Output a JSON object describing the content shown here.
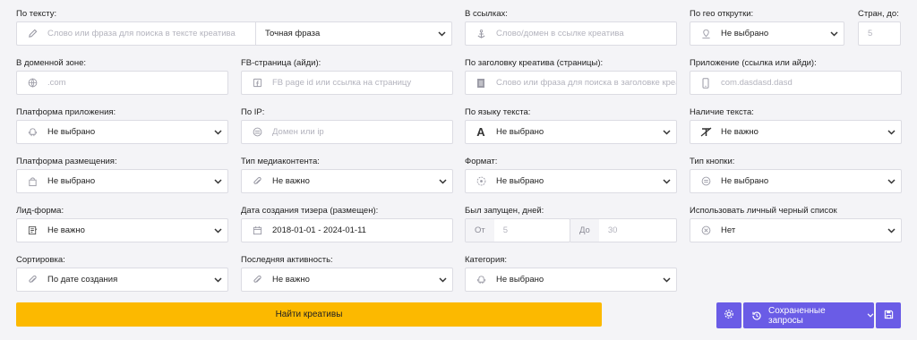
{
  "row1": {
    "text": {
      "label": "По тексту:",
      "placeholder": "Слово или фраза для поиска в тексте креатива",
      "mode": "Точная фраза"
    },
    "links": {
      "label": "В ссылках:",
      "placeholder": "Слово/домен в ссылке креатива"
    },
    "geo": {
      "label": "По гео открутки:",
      "value": "Не выбрано"
    },
    "countries": {
      "label": "Стран, до:",
      "placeholder": "5"
    }
  },
  "row2": {
    "domain_zone": {
      "label": "В доменной зоне:",
      "placeholder": ".com"
    },
    "fb_page": {
      "label": "FB-страница (айди):",
      "placeholder": "FB page id или ссылка на страницу"
    },
    "headline": {
      "label": "По заголовку креатива (страницы):",
      "placeholder": "Слово или фраза для поиска в заголовке креатива"
    },
    "app": {
      "label": "Приложение (ссылка или айди):",
      "placeholder": "com.dasdasd.dasd"
    }
  },
  "row3": {
    "app_platform": {
      "label": "Платформа приложения:",
      "value": "Не выбрано"
    },
    "ip": {
      "label": "По IP:",
      "placeholder": "Домен или  ip"
    },
    "text_lang": {
      "label": "По языку текста:",
      "value": "Не выбрано"
    },
    "has_text": {
      "label": "Наличие текста:",
      "value": "Не важно"
    }
  },
  "row4": {
    "placement": {
      "label": "Платформа размещения:",
      "value": "Не выбрано"
    },
    "media_type": {
      "label": "Тип медиаконтента:",
      "value": "Не важно"
    },
    "format": {
      "label": "Формат:",
      "value": "Не выбрано"
    },
    "button_type": {
      "label": "Тип кнопки:",
      "value": "Не выбрано"
    }
  },
  "row5": {
    "lead_form": {
      "label": "Лид-форма:",
      "value": "Не важно"
    },
    "created": {
      "label": "Дата создания тизера (размещен):",
      "value": "2018-01-01 - 2024-01-11"
    },
    "days_running": {
      "label": "Был запущен, дней:",
      "from_label": "От",
      "from_placeholder": "5",
      "to_label": "До",
      "to_placeholder": "30"
    },
    "blacklist": {
      "label": "Использовать личный черный список",
      "value": "Нет"
    }
  },
  "row6": {
    "sort": {
      "label": "Сортировка:",
      "value": "По дате создания"
    },
    "activity": {
      "label": "Последняя активность:",
      "value": "Не важно"
    },
    "category": {
      "label": "Категория:",
      "value": "Не выбрано"
    }
  },
  "actions": {
    "find": "Найти креативы",
    "saved": "Сохраненные запросы"
  },
  "colors": {
    "accent": "#fcb900",
    "purple": "#6a5ce6"
  },
  "icons": [
    "pencil-icon",
    "anchor-icon",
    "map-pin-icon",
    "globe-icon",
    "facebook-icon",
    "document-icon",
    "phone-icon",
    "android-icon",
    "server-icon",
    "font-icon",
    "no-text-icon",
    "bag-icon",
    "paperclip-icon",
    "format-icon",
    "button-icon",
    "form-icon",
    "calendar-icon",
    "cancel-icon",
    "gear-icon",
    "history-icon",
    "save-icon"
  ]
}
